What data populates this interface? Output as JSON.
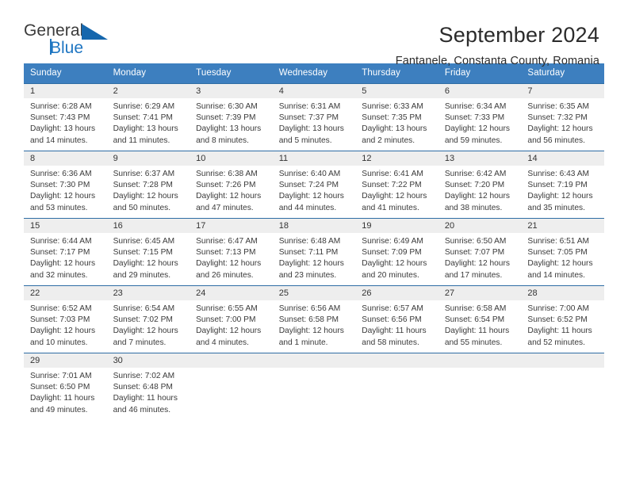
{
  "brand": {
    "name_top": "General",
    "name_bottom": "Blue",
    "accent_color": "#1667ad"
  },
  "header": {
    "title": "September 2024",
    "location": "Fantanele, Constanta County, Romania"
  },
  "calendar": {
    "header_bg": "#3d7fbf",
    "daynames": [
      "Sunday",
      "Monday",
      "Tuesday",
      "Wednesday",
      "Thursday",
      "Friday",
      "Saturday"
    ],
    "weeks": [
      [
        {
          "date": "1",
          "sunrise": "Sunrise: 6:28 AM",
          "sunset": "Sunset: 7:43 PM",
          "daylight1": "Daylight: 13 hours",
          "daylight2": "and 14 minutes."
        },
        {
          "date": "2",
          "sunrise": "Sunrise: 6:29 AM",
          "sunset": "Sunset: 7:41 PM",
          "daylight1": "Daylight: 13 hours",
          "daylight2": "and 11 minutes."
        },
        {
          "date": "3",
          "sunrise": "Sunrise: 6:30 AM",
          "sunset": "Sunset: 7:39 PM",
          "daylight1": "Daylight: 13 hours",
          "daylight2": "and 8 minutes."
        },
        {
          "date": "4",
          "sunrise": "Sunrise: 6:31 AM",
          "sunset": "Sunset: 7:37 PM",
          "daylight1": "Daylight: 13 hours",
          "daylight2": "and 5 minutes."
        },
        {
          "date": "5",
          "sunrise": "Sunrise: 6:33 AM",
          "sunset": "Sunset: 7:35 PM",
          "daylight1": "Daylight: 13 hours",
          "daylight2": "and 2 minutes."
        },
        {
          "date": "6",
          "sunrise": "Sunrise: 6:34 AM",
          "sunset": "Sunset: 7:33 PM",
          "daylight1": "Daylight: 12 hours",
          "daylight2": "and 59 minutes."
        },
        {
          "date": "7",
          "sunrise": "Sunrise: 6:35 AM",
          "sunset": "Sunset: 7:32 PM",
          "daylight1": "Daylight: 12 hours",
          "daylight2": "and 56 minutes."
        }
      ],
      [
        {
          "date": "8",
          "sunrise": "Sunrise: 6:36 AM",
          "sunset": "Sunset: 7:30 PM",
          "daylight1": "Daylight: 12 hours",
          "daylight2": "and 53 minutes."
        },
        {
          "date": "9",
          "sunrise": "Sunrise: 6:37 AM",
          "sunset": "Sunset: 7:28 PM",
          "daylight1": "Daylight: 12 hours",
          "daylight2": "and 50 minutes."
        },
        {
          "date": "10",
          "sunrise": "Sunrise: 6:38 AM",
          "sunset": "Sunset: 7:26 PM",
          "daylight1": "Daylight: 12 hours",
          "daylight2": "and 47 minutes."
        },
        {
          "date": "11",
          "sunrise": "Sunrise: 6:40 AM",
          "sunset": "Sunset: 7:24 PM",
          "daylight1": "Daylight: 12 hours",
          "daylight2": "and 44 minutes."
        },
        {
          "date": "12",
          "sunrise": "Sunrise: 6:41 AM",
          "sunset": "Sunset: 7:22 PM",
          "daylight1": "Daylight: 12 hours",
          "daylight2": "and 41 minutes."
        },
        {
          "date": "13",
          "sunrise": "Sunrise: 6:42 AM",
          "sunset": "Sunset: 7:20 PM",
          "daylight1": "Daylight: 12 hours",
          "daylight2": "and 38 minutes."
        },
        {
          "date": "14",
          "sunrise": "Sunrise: 6:43 AM",
          "sunset": "Sunset: 7:19 PM",
          "daylight1": "Daylight: 12 hours",
          "daylight2": "and 35 minutes."
        }
      ],
      [
        {
          "date": "15",
          "sunrise": "Sunrise: 6:44 AM",
          "sunset": "Sunset: 7:17 PM",
          "daylight1": "Daylight: 12 hours",
          "daylight2": "and 32 minutes."
        },
        {
          "date": "16",
          "sunrise": "Sunrise: 6:45 AM",
          "sunset": "Sunset: 7:15 PM",
          "daylight1": "Daylight: 12 hours",
          "daylight2": "and 29 minutes."
        },
        {
          "date": "17",
          "sunrise": "Sunrise: 6:47 AM",
          "sunset": "Sunset: 7:13 PM",
          "daylight1": "Daylight: 12 hours",
          "daylight2": "and 26 minutes."
        },
        {
          "date": "18",
          "sunrise": "Sunrise: 6:48 AM",
          "sunset": "Sunset: 7:11 PM",
          "daylight1": "Daylight: 12 hours",
          "daylight2": "and 23 minutes."
        },
        {
          "date": "19",
          "sunrise": "Sunrise: 6:49 AM",
          "sunset": "Sunset: 7:09 PM",
          "daylight1": "Daylight: 12 hours",
          "daylight2": "and 20 minutes."
        },
        {
          "date": "20",
          "sunrise": "Sunrise: 6:50 AM",
          "sunset": "Sunset: 7:07 PM",
          "daylight1": "Daylight: 12 hours",
          "daylight2": "and 17 minutes."
        },
        {
          "date": "21",
          "sunrise": "Sunrise: 6:51 AM",
          "sunset": "Sunset: 7:05 PM",
          "daylight1": "Daylight: 12 hours",
          "daylight2": "and 14 minutes."
        }
      ],
      [
        {
          "date": "22",
          "sunrise": "Sunrise: 6:52 AM",
          "sunset": "Sunset: 7:03 PM",
          "daylight1": "Daylight: 12 hours",
          "daylight2": "and 10 minutes."
        },
        {
          "date": "23",
          "sunrise": "Sunrise: 6:54 AM",
          "sunset": "Sunset: 7:02 PM",
          "daylight1": "Daylight: 12 hours",
          "daylight2": "and 7 minutes."
        },
        {
          "date": "24",
          "sunrise": "Sunrise: 6:55 AM",
          "sunset": "Sunset: 7:00 PM",
          "daylight1": "Daylight: 12 hours",
          "daylight2": "and 4 minutes."
        },
        {
          "date": "25",
          "sunrise": "Sunrise: 6:56 AM",
          "sunset": "Sunset: 6:58 PM",
          "daylight1": "Daylight: 12 hours",
          "daylight2": "and 1 minute."
        },
        {
          "date": "26",
          "sunrise": "Sunrise: 6:57 AM",
          "sunset": "Sunset: 6:56 PM",
          "daylight1": "Daylight: 11 hours",
          "daylight2": "and 58 minutes."
        },
        {
          "date": "27",
          "sunrise": "Sunrise: 6:58 AM",
          "sunset": "Sunset: 6:54 PM",
          "daylight1": "Daylight: 11 hours",
          "daylight2": "and 55 minutes."
        },
        {
          "date": "28",
          "sunrise": "Sunrise: 7:00 AM",
          "sunset": "Sunset: 6:52 PM",
          "daylight1": "Daylight: 11 hours",
          "daylight2": "and 52 minutes."
        }
      ],
      [
        {
          "date": "29",
          "sunrise": "Sunrise: 7:01 AM",
          "sunset": "Sunset: 6:50 PM",
          "daylight1": "Daylight: 11 hours",
          "daylight2": "and 49 minutes."
        },
        {
          "date": "30",
          "sunrise": "Sunrise: 7:02 AM",
          "sunset": "Sunset: 6:48 PM",
          "daylight1": "Daylight: 11 hours",
          "daylight2": "and 46 minutes."
        },
        {
          "date": "",
          "sunrise": "",
          "sunset": "",
          "daylight1": "",
          "daylight2": ""
        },
        {
          "date": "",
          "sunrise": "",
          "sunset": "",
          "daylight1": "",
          "daylight2": ""
        },
        {
          "date": "",
          "sunrise": "",
          "sunset": "",
          "daylight1": "",
          "daylight2": ""
        },
        {
          "date": "",
          "sunrise": "",
          "sunset": "",
          "daylight1": "",
          "daylight2": ""
        },
        {
          "date": "",
          "sunrise": "",
          "sunset": "",
          "daylight1": "",
          "daylight2": ""
        }
      ]
    ]
  }
}
